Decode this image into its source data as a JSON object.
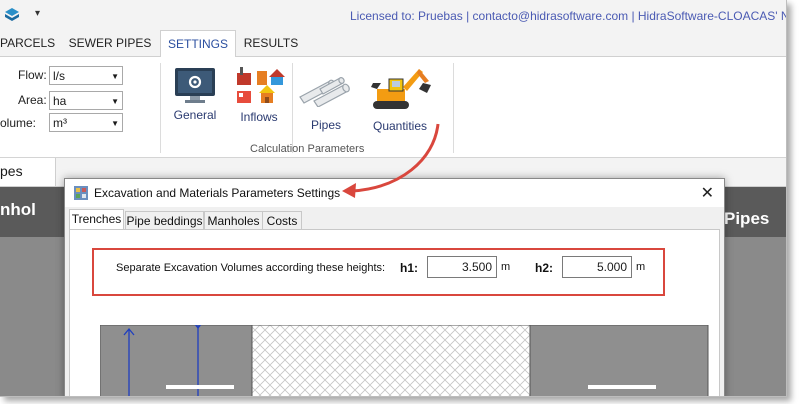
{
  "titlebar": {
    "qat_arrow": "▾",
    "license": "Licensed to: Pruebas | contacto@hidrasoftware.com | HidraSoftware-CLOACAS' New"
  },
  "ribbon_tabs": [
    {
      "label": "PARCELS"
    },
    {
      "label": "SEWER PIPES"
    },
    {
      "label": "SETTINGS"
    },
    {
      "label": "RESULTS"
    }
  ],
  "units": {
    "flow_label": "Flow:",
    "flow_value": "l/s",
    "area_label": "Area:",
    "area_value": "ha",
    "volume_label": "olume:",
    "volume_value": "m³"
  },
  "ribbon_buttons": {
    "general": "General",
    "inflows": "Inflows",
    "pipes": "Pipes",
    "quantities": "Quantities",
    "group_label": "Calculation Parameters"
  },
  "document": {
    "tab_label": "pes",
    "left_header": "nhol",
    "right_header": "Pipes"
  },
  "dialog": {
    "title": "Excavation and Materials Parameters Settings",
    "close": "✕",
    "tabs": [
      {
        "label": "Trenches"
      },
      {
        "label": "Pipe beddings"
      },
      {
        "label": "Manholes"
      },
      {
        "label": "Costs"
      }
    ],
    "heights": {
      "label": "Separate Excavation Volumes according these heights:",
      "h1_label": "h1:",
      "h1_value": "3.500",
      "h1_unit": "m",
      "h2_label": "h2:",
      "h2_value": "5.000",
      "h2_unit": "m"
    }
  },
  "colors": {
    "accent": "#2b4fa0",
    "annotation": "#d9473d",
    "license": "#4a5ab3"
  }
}
